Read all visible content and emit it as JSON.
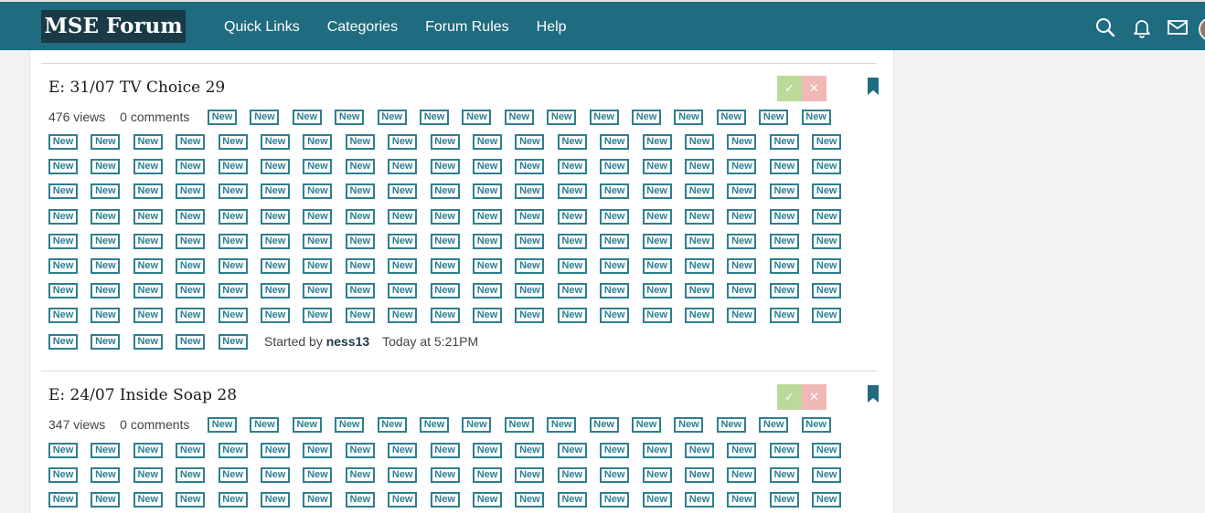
{
  "header": {
    "logo": "MSE Forum",
    "nav": [
      "Quick Links",
      "Categories",
      "Forum Rules",
      "Help"
    ],
    "icons": [
      "search-icon",
      "bell-icon",
      "mail-icon"
    ],
    "brand_color": "#1f6c80"
  },
  "badge_label": "New",
  "threads": [
    {
      "title": "E: 31/07 TV Choice 29",
      "views": "476 views",
      "comments": "0 comments",
      "vote_yes": "✓",
      "vote_no": "✕",
      "started_by_label": "Started by",
      "author": "ness13",
      "time": "Today at 5:21PM"
    },
    {
      "title": "E: 24/07 Inside Soap 28",
      "views": "347 views",
      "comments": "0 comments",
      "vote_yes": "✓",
      "vote_no": "✕"
    }
  ]
}
